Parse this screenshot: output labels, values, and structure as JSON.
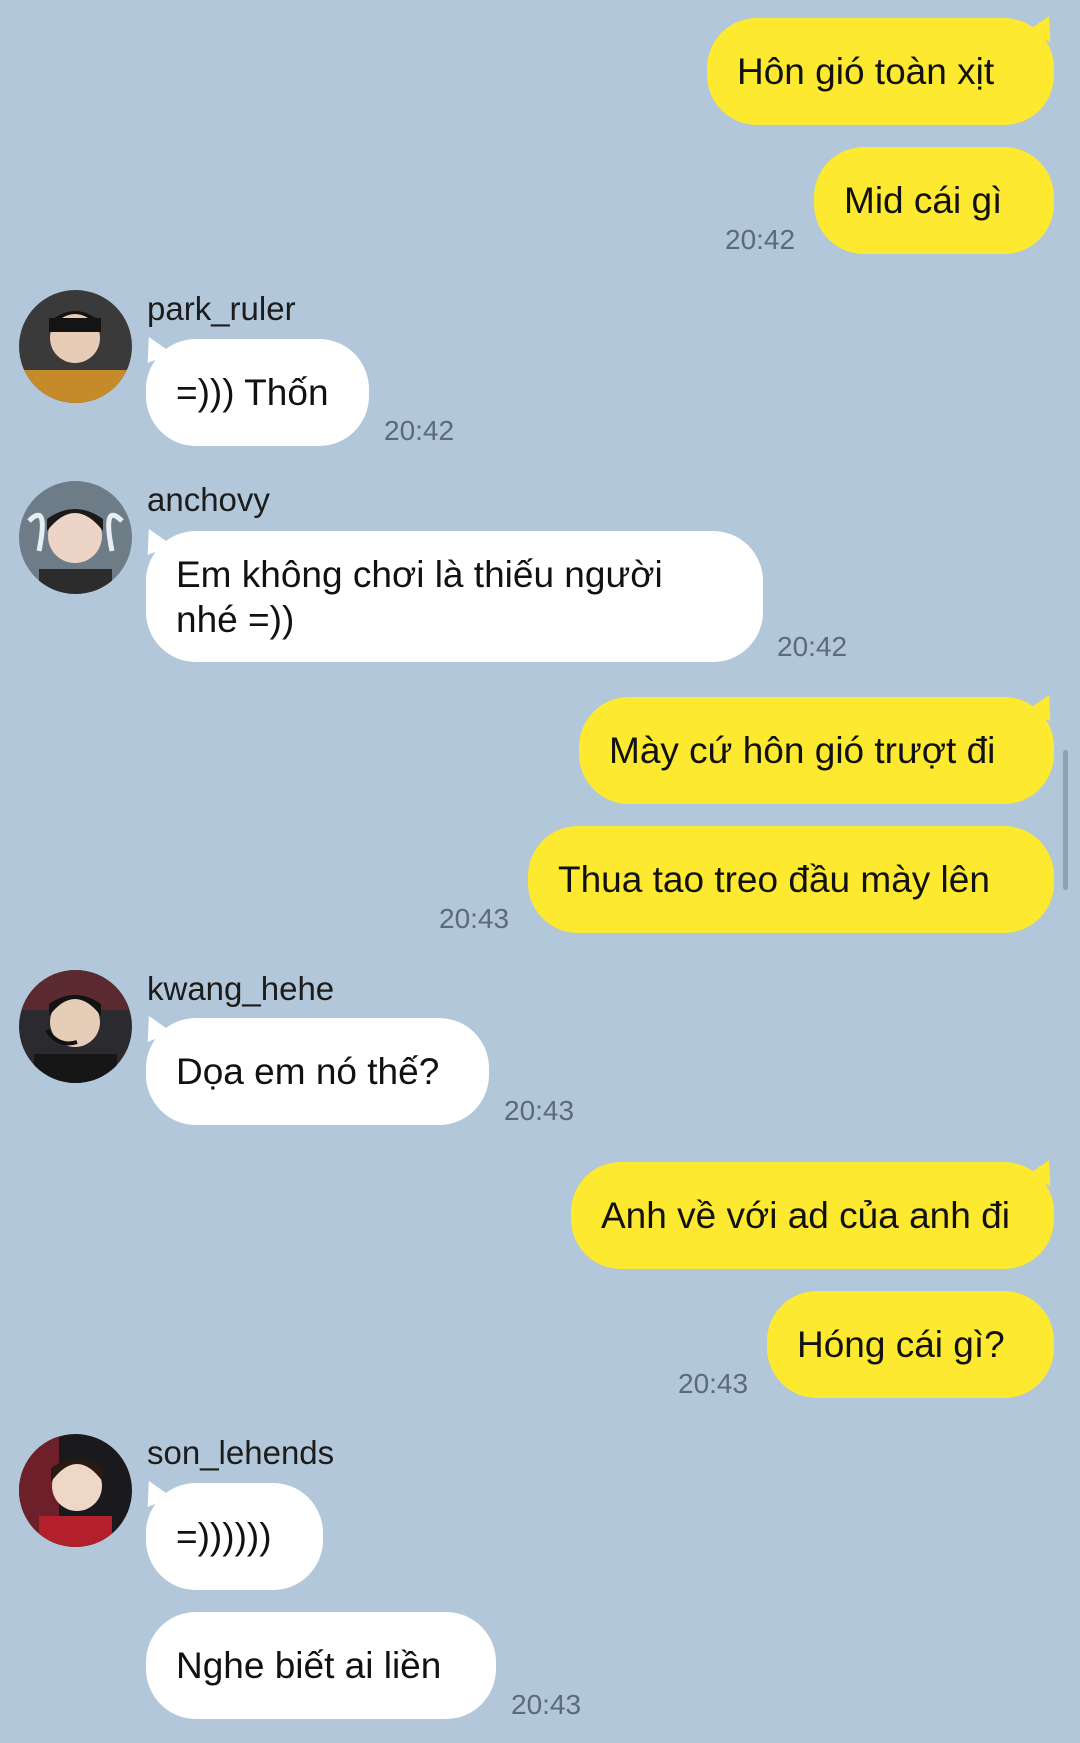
{
  "messages": {
    "m1": {
      "text": "Hôn gió toàn xịt"
    },
    "m2": {
      "text": "Mid cái gì",
      "time": "20:42"
    },
    "m3": {
      "sender": "park_ruler",
      "text": "=))) Thốn",
      "time": "20:42"
    },
    "m4": {
      "sender": "anchovy",
      "text": "Em không chơi là thiếu người nhé =))",
      "time": "20:42"
    },
    "m5": {
      "text": "Mày cứ hôn gió trượt đi"
    },
    "m6": {
      "text": "Thua tao treo đầu mày lên",
      "time": "20:43"
    },
    "m7": {
      "sender": "kwang_hehe",
      "text": "Dọa em nó thế?",
      "time": "20:43"
    },
    "m8": {
      "text": "Anh về với ad của anh đi"
    },
    "m9": {
      "text": "Hóng cái gì?",
      "time": "20:43"
    },
    "m10": {
      "sender": "son_lehends",
      "text": "=))))))"
    },
    "m11": {
      "text": "Nghe biết ai liền",
      "time": "20:43"
    }
  },
  "colors": {
    "background": "#b2c7d9",
    "my_bubble": "#fde92f",
    "other_bubble": "#ffffff",
    "timestamp": "#5b6b78"
  }
}
